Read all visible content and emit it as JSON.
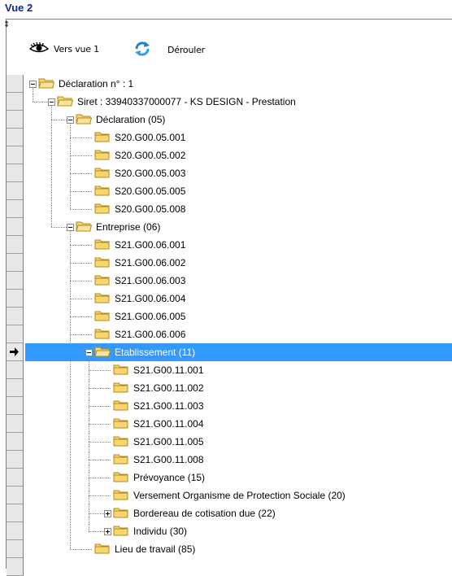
{
  "window": {
    "title": "Vue 2"
  },
  "toolbar": {
    "resize_glyph": "⇕",
    "view_button_label": "Vers vue 1",
    "expand_button_label": "Dérouler"
  },
  "tree": {
    "nodes": [
      {
        "label": "Déclaration n° : 1",
        "level": 0,
        "expander": "minus"
      },
      {
        "label": "Siret : 33940337000077 - KS DESIGN - Prestation",
        "level": 1,
        "expander": "minus"
      },
      {
        "label": "Déclaration (05)",
        "level": 2,
        "expander": "minus"
      },
      {
        "label": "S20.G00.05.001",
        "level": 3,
        "expander": "none"
      },
      {
        "label": "S20.G00.05.002",
        "level": 3,
        "expander": "none"
      },
      {
        "label": "S20.G00.05.003",
        "level": 3,
        "expander": "none"
      },
      {
        "label": "S20.G00.05.005",
        "level": 3,
        "expander": "none"
      },
      {
        "label": "S20.G00.05.008",
        "level": 3,
        "expander": "none"
      },
      {
        "label": "Entreprise (06)",
        "level": 2,
        "expander": "minus"
      },
      {
        "label": "S21.G00.06.001",
        "level": 3,
        "expander": "none"
      },
      {
        "label": "S21.G00.06.002",
        "level": 3,
        "expander": "none"
      },
      {
        "label": "S21.G00.06.003",
        "level": 3,
        "expander": "none"
      },
      {
        "label": "S21.G00.06.004",
        "level": 3,
        "expander": "none"
      },
      {
        "label": "S21.G00.06.005",
        "level": 3,
        "expander": "none"
      },
      {
        "label": "S21.G00.06.006",
        "level": 3,
        "expander": "none"
      },
      {
        "label": "Etablissement (11)",
        "level": 3,
        "expander": "minus",
        "selected": true
      },
      {
        "label": "S21.G00.11.001",
        "level": 4,
        "expander": "none"
      },
      {
        "label": "S21.G00.11.002",
        "level": 4,
        "expander": "none"
      },
      {
        "label": "S21.G00.11.003",
        "level": 4,
        "expander": "none"
      },
      {
        "label": "S21.G00.11.004",
        "level": 4,
        "expander": "none"
      },
      {
        "label": "S21.G00.11.005",
        "level": 4,
        "expander": "none"
      },
      {
        "label": "S21.G00.11.008",
        "level": 4,
        "expander": "none"
      },
      {
        "label": "Prévoyance (15)",
        "level": 4,
        "expander": "none"
      },
      {
        "label": "Versement Organisme de Protection Sociale (20)",
        "level": 4,
        "expander": "none"
      },
      {
        "label": "Bordereau de cotisation due (22)",
        "level": 4,
        "expander": "plus"
      },
      {
        "label": "Individu (30)",
        "level": 4,
        "expander": "plus"
      },
      {
        "label": "Lieu de travail (85)",
        "level": 3,
        "expander": "none"
      }
    ]
  },
  "colors": {
    "selection": "#3399ff",
    "title": "#0a2896",
    "folder_fill": "#f9d56b",
    "folder_stroke": "#b08a1e"
  },
  "icons": {
    "view": "eye-icon",
    "refresh": "refresh-arrows-icon",
    "folder": "folder-icon",
    "row_pointer": "row-pointer-arrow-icon"
  }
}
